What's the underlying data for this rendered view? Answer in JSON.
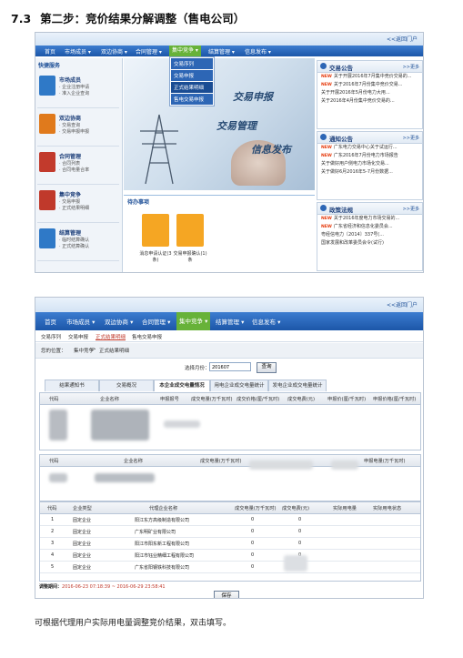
{
  "heading": {
    "number": "7.3",
    "title": "第二步：竞价结果分解调整（售电公司）"
  },
  "screen1": {
    "portal_link": "<<返回门户",
    "nav": [
      "首页",
      "市场成员 ▾",
      "双边协商 ▾",
      "合同管理 ▾",
      "集中竞争 ▾",
      "结算管理 ▾",
      "信息发布 ▾"
    ],
    "dropdown": [
      "交易序列",
      "交易申报",
      "正式结果明细",
      "售电交易申报"
    ],
    "left_title": "快捷服务",
    "left_items": [
      {
        "name": "市场成员",
        "subs": [
          "· 企业注册申请",
          "· 准入企业查询"
        ]
      },
      {
        "name": "双边协商",
        "subs": [
          "· 交易查询",
          "· 交易申报申报"
        ]
      },
      {
        "name": "合同管理",
        "subs": [
          "· 合同列表",
          "· 合同电量合率"
        ]
      },
      {
        "name": "集中竞争",
        "subs": [
          "· 交易申报",
          "· 正式结果明细"
        ]
      },
      {
        "name": "结算管理",
        "subs": [
          "· 临时结算确认",
          "· 正式结算确认"
        ]
      }
    ],
    "banner_lines": [
      "交易申报",
      "交易管理",
      "信息发布"
    ],
    "todo_title": "待办事项",
    "todo_items": [
      "消息申请认证(3条)",
      "交易申报确认(1)条"
    ],
    "notices": {
      "title": "交易公告",
      "more": ">>更多",
      "lines": [
        "关于开展2016年7月集中竞价交易的...",
        "关于2016年7月份集中竞价交易...",
        "关于开展2016年5月份电力大用...",
        "关于2016年4月份集中竞价交易的..."
      ]
    },
    "notifications": {
      "title": "通知公告",
      "more": ">>更多",
      "lines": [
        "广东电力交易中心关于试运行...",
        "广东2016年7月份电力市场报告",
        "关于做好用户侧电力市场化交易...",
        "关于做好6月2016年5-7月份数据..."
      ]
    },
    "policies": {
      "title": "政策法规",
      "more": ">>更多",
      "lines": [
        "关于2016年度电力市场交易的...",
        "广东省经济和信息化委员会...",
        "粤经信电力〔2014〕337号(...",
        "国家发展和改革委员会令(试行)"
      ]
    }
  },
  "screen2": {
    "portal_link": "<<返回门户",
    "nav": [
      "首页",
      "市场成员 ▾",
      "双边协商 ▾",
      "合同管理 ▾",
      "集中竞争 ▾",
      "结算管理 ▾",
      "信息发布 ▾"
    ],
    "sub_tabs": [
      "交易序列",
      "交易申报",
      "正式结果明细",
      "售电交易申报"
    ],
    "crumb": [
      "您的位置：",
      "集中竞争",
      "正式结果明细"
    ],
    "form_label": "选择月份：",
    "form_value": "201607",
    "query_button": "查询",
    "tabs": [
      "结果通知书",
      "交易概况",
      "本企业成交电量情况",
      "用电企业成交电量统计",
      "发电企业成交电量统计"
    ],
    "table1_headers": [
      "代码",
      "企业名称",
      "申报报号",
      "成交电量(万千瓦时)",
      "成交价格(厘/千瓦时)",
      "成交电费(元)",
      "申报价(厘/千瓦时)",
      "申报价格(厘/千瓦时)"
    ],
    "table2_headers": [
      "代码",
      "企业名称",
      "成交电量(万千瓦时)",
      "申报电量(万千瓦时)"
    ],
    "table3_headers": [
      "代码",
      "企业类型",
      "代理企业名称",
      "成交电量(万千瓦时)",
      "成交电费(元)",
      "实际用电量",
      "实际用电状态"
    ],
    "table3_rows": [
      [
        "1",
        "固定企业",
        "阳江东方高级制造有限公司",
        "0",
        "0"
      ],
      [
        "2",
        "固定企业",
        "广东明矿业有限公司",
        "0",
        "0"
      ],
      [
        "3",
        "固定企业",
        "阳江市阳东新工程有限公司",
        "0",
        "0"
      ],
      [
        "4",
        "固定企业",
        "阳江市钰业精细工程有限公司",
        "0",
        "0"
      ],
      [
        "5",
        "固定企业",
        "广东省阳钢铁科技有限公司",
        "0",
        "0"
      ]
    ],
    "adjust_label": "调整期间：",
    "adjust_period": "2016-06-23 07:18:39 ~ 2016-06-29 23:58:41",
    "save_button": "保存"
  },
  "caption": "可根据代理用户实际用电量调整竞价结果，双击填写。"
}
